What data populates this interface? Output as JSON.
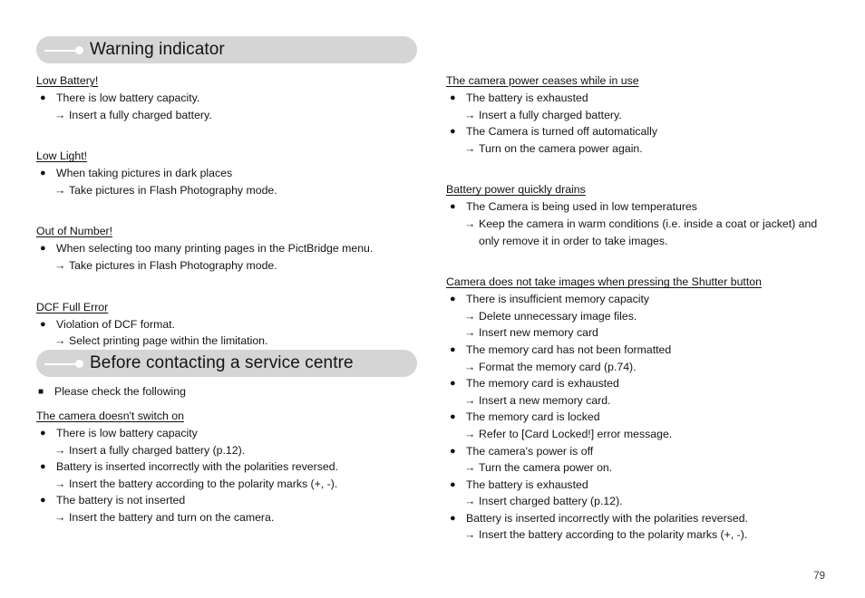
{
  "page": {
    "number": "79"
  },
  "banners": [
    {
      "title": "Warning indicator",
      "icon": "line-dot-bullet"
    },
    {
      "title": "Before contacting a service centre",
      "icon": "line-dot-bullet"
    }
  ],
  "marks": {
    "bullet": "●",
    "arrow": "→",
    "square": "■"
  },
  "left_column": {
    "sections": [
      {
        "heading": "Low Battery!",
        "items": [
          {
            "type": "bullet",
            "text": "There is low battery capacity."
          },
          {
            "type": "arrow",
            "text": "Insert a fully charged battery."
          }
        ]
      },
      {
        "heading": "Low Light!",
        "items": [
          {
            "type": "bullet",
            "text": "When taking pictures in dark places"
          },
          {
            "type": "arrow",
            "text": "Take pictures in Flash Photography mode."
          }
        ]
      },
      {
        "heading": "Out of Number!",
        "items": [
          {
            "type": "bullet",
            "text": "When selecting too many printing pages in the PictBridge menu."
          },
          {
            "type": "arrow",
            "text": "Take pictures in Flash Photography mode."
          }
        ]
      },
      {
        "heading": "DCF Full Error",
        "items": [
          {
            "type": "bullet",
            "text": "Violation of DCF format."
          },
          {
            "type": "arrow",
            "text": "Select printing page within the limitation."
          }
        ]
      }
    ],
    "check_note": "Please check the following",
    "sections2": [
      {
        "heading": "The camera doesn't switch on",
        "items": [
          {
            "type": "bullet",
            "text": "There is low battery capacity"
          },
          {
            "type": "arrow",
            "text": "Insert a fully charged battery (p.12)."
          },
          {
            "type": "bullet",
            "text": "Battery is inserted incorrectly with the polarities reversed."
          },
          {
            "type": "arrow",
            "text": "Insert the battery according to the polarity marks (+, -)."
          },
          {
            "type": "bullet",
            "text": "The battery is not inserted"
          },
          {
            "type": "arrow",
            "text": "Insert the battery and turn on the camera."
          }
        ]
      }
    ]
  },
  "right_column": {
    "sections": [
      {
        "heading": "The camera power ceases while in use",
        "items": [
          {
            "type": "bullet",
            "text": "The battery is exhausted"
          },
          {
            "type": "arrow",
            "text": "Insert a fully charged battery."
          },
          {
            "type": "bullet",
            "text": "The Camera is turned off automatically"
          },
          {
            "type": "arrow",
            "text": "Turn on the camera power again."
          }
        ]
      },
      {
        "heading": "Battery power quickly drains",
        "items": [
          {
            "type": "bullet",
            "text": "The Camera is being used in low temperatures"
          },
          {
            "type": "arrow",
            "text": "Keep the camera in warm conditions (i.e. inside a coat or jacket) and",
            "continuation": "only remove it in order to take images."
          }
        ]
      },
      {
        "heading": "Camera does not take images when pressing the Shutter button",
        "items": [
          {
            "type": "bullet",
            "text": "There is insufficient memory capacity"
          },
          {
            "type": "arrow",
            "text": "Delete unnecessary image files."
          },
          {
            "type": "arrow",
            "text": "Insert new memory card"
          },
          {
            "type": "bullet",
            "text": "The memory card has not been formatted"
          },
          {
            "type": "arrow",
            "text": "Format the memory card (p.74)."
          },
          {
            "type": "bullet",
            "text": "The memory card is exhausted"
          },
          {
            "type": "arrow",
            "text": "Insert a new memory card."
          },
          {
            "type": "bullet",
            "text": "The memory card is locked"
          },
          {
            "type": "arrow",
            "text": "Refer to [Card Locked!] error message."
          },
          {
            "type": "bullet",
            "text": "The camera's power is off"
          },
          {
            "type": "arrow",
            "text": "Turn the camera power on."
          },
          {
            "type": "bullet",
            "text": "The battery is exhausted"
          },
          {
            "type": "arrow",
            "text": "Insert charged battery (p.12)."
          },
          {
            "type": "bullet",
            "text": "Battery is inserted incorrectly with the polarities reversed."
          },
          {
            "type": "arrow",
            "text": "Insert the battery according to the polarity marks (+, -)."
          }
        ]
      }
    ]
  }
}
